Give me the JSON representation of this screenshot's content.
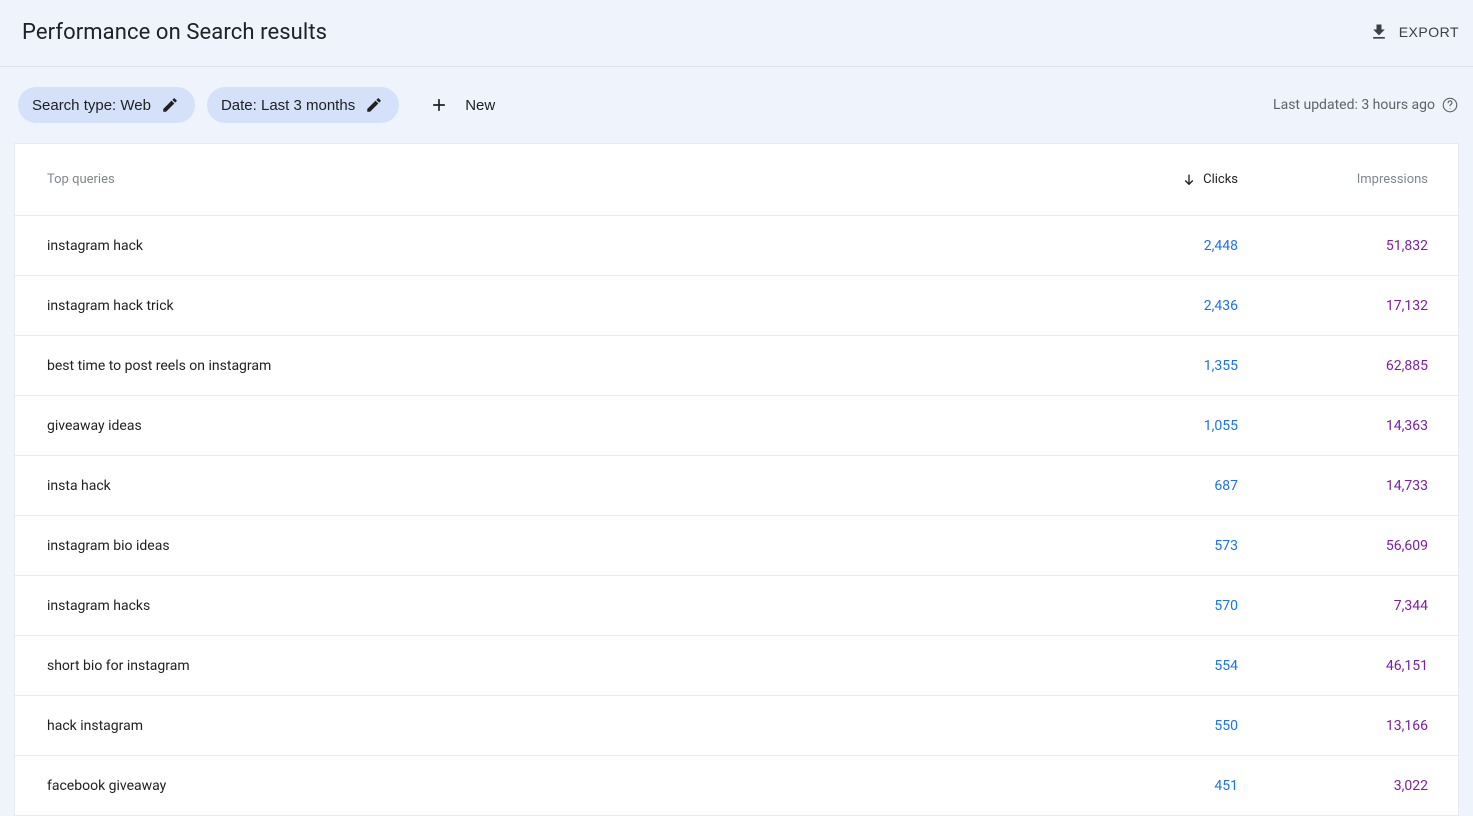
{
  "header": {
    "title": "Performance on Search results",
    "export_label": "EXPORT"
  },
  "filters": {
    "search_type": "Search type: Web",
    "date_range": "Date: Last 3 months",
    "new_label": "New",
    "last_updated": "Last updated: 3 hours ago"
  },
  "table": {
    "columns": {
      "query": "Top queries",
      "clicks": "Clicks",
      "impressions": "Impressions"
    },
    "rows": [
      {
        "query": "instagram hack",
        "clicks": "2,448",
        "impressions": "51,832"
      },
      {
        "query": "instagram hack trick",
        "clicks": "2,436",
        "impressions": "17,132"
      },
      {
        "query": "best time to post reels on instagram",
        "clicks": "1,355",
        "impressions": "62,885"
      },
      {
        "query": "giveaway ideas",
        "clicks": "1,055",
        "impressions": "14,363"
      },
      {
        "query": "insta hack",
        "clicks": "687",
        "impressions": "14,733"
      },
      {
        "query": "instagram bio ideas",
        "clicks": "573",
        "impressions": "56,609"
      },
      {
        "query": "instagram hacks",
        "clicks": "570",
        "impressions": "7,344"
      },
      {
        "query": "short bio for instagram",
        "clicks": "554",
        "impressions": "46,151"
      },
      {
        "query": "hack instagram",
        "clicks": "550",
        "impressions": "13,166"
      },
      {
        "query": "facebook giveaway",
        "clicks": "451",
        "impressions": "3,022"
      }
    ]
  }
}
